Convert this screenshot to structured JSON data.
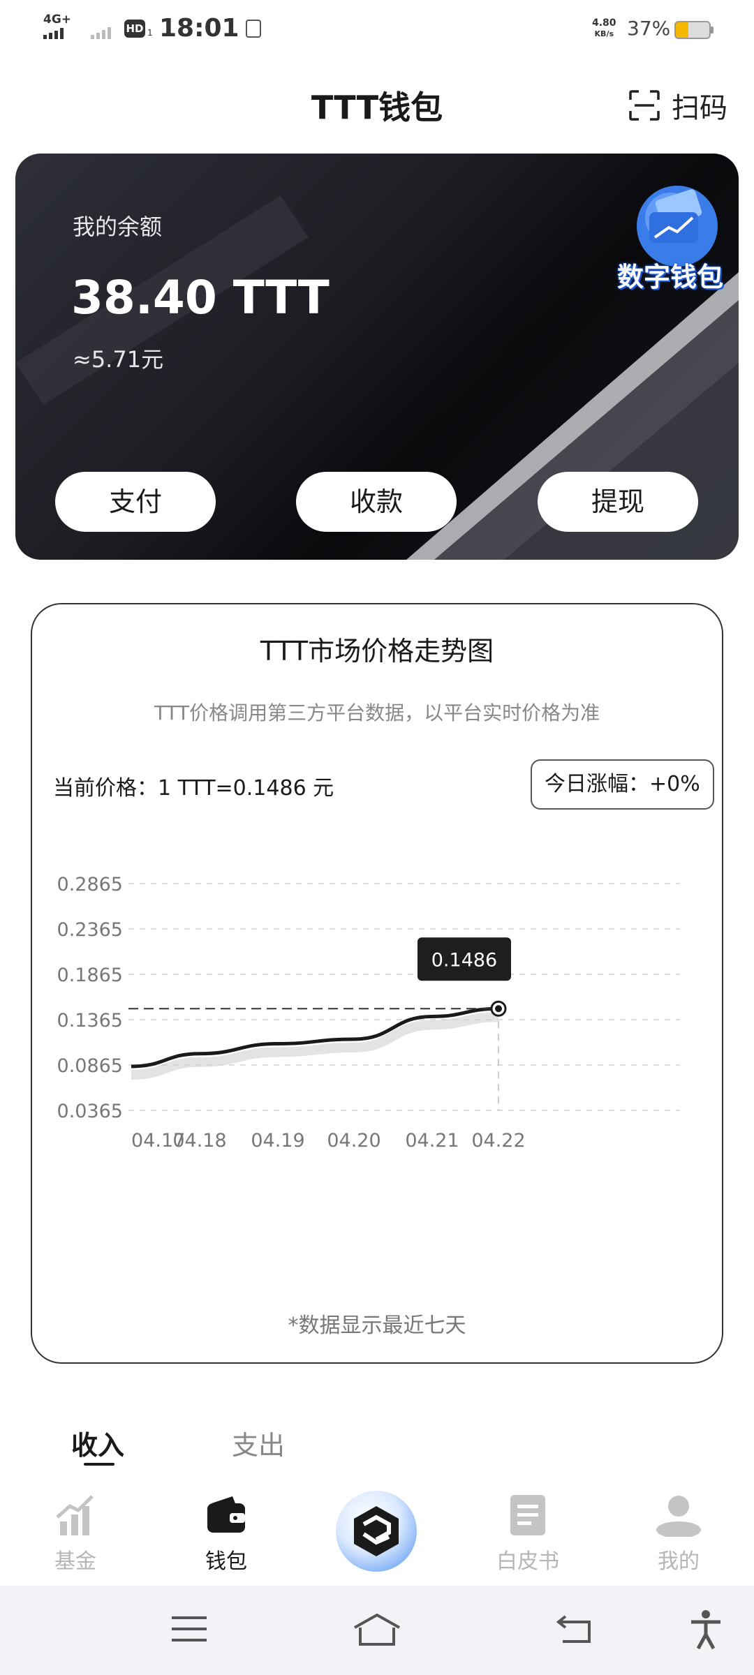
{
  "status_bar": {
    "network": "4G+",
    "hd": "HD",
    "hd_sub": "1",
    "time": "18:01",
    "speed_value": "4.80",
    "speed_unit": "KB/s",
    "battery_pct": "37%",
    "battery_level": 0.37
  },
  "header": {
    "title": "TTT钱包",
    "scan_label": "扫码"
  },
  "balance_card": {
    "label": "我的余额",
    "amount": "38.40 TTT",
    "approx": "≈5.71元",
    "badge_text": "数字钱包",
    "buttons": {
      "pay": "支付",
      "receive": "收款",
      "withdraw": "提现"
    }
  },
  "price_section": {
    "title": "TTT市场价格走势图",
    "subtitle": "TTT价格调用第三方平台数据，以平台实时价格为准",
    "current_price": "当前价格：1 TTT=0.1486 元",
    "daily_change": "今日涨幅：+0%",
    "note": "*数据显示最近七天"
  },
  "chart_data": {
    "type": "line",
    "x": [
      "04.17",
      "04.18",
      "04.19",
      "04.20",
      "04.21",
      "04.22"
    ],
    "series": [
      {
        "values": [
          0.085,
          0.099,
          0.11,
          0.115,
          0.14,
          0.1486
        ]
      }
    ],
    "y_ticks": [
      "0.0365",
      "0.0865",
      "0.1365",
      "0.1865",
      "0.2365",
      "0.2865"
    ],
    "ylim": [
      0.0365,
      0.2865
    ],
    "grid": true,
    "highlight": {
      "x": "04.22",
      "label": "0.1486"
    },
    "colors": {
      "line": "#1a1a1a",
      "grid": "#dddddd"
    }
  },
  "tabs": {
    "income": "收入",
    "expense": "支出"
  },
  "bottom_nav": {
    "fund": "基金",
    "wallet": "钱包",
    "whitepaper": "白皮书",
    "mine": "我的"
  }
}
